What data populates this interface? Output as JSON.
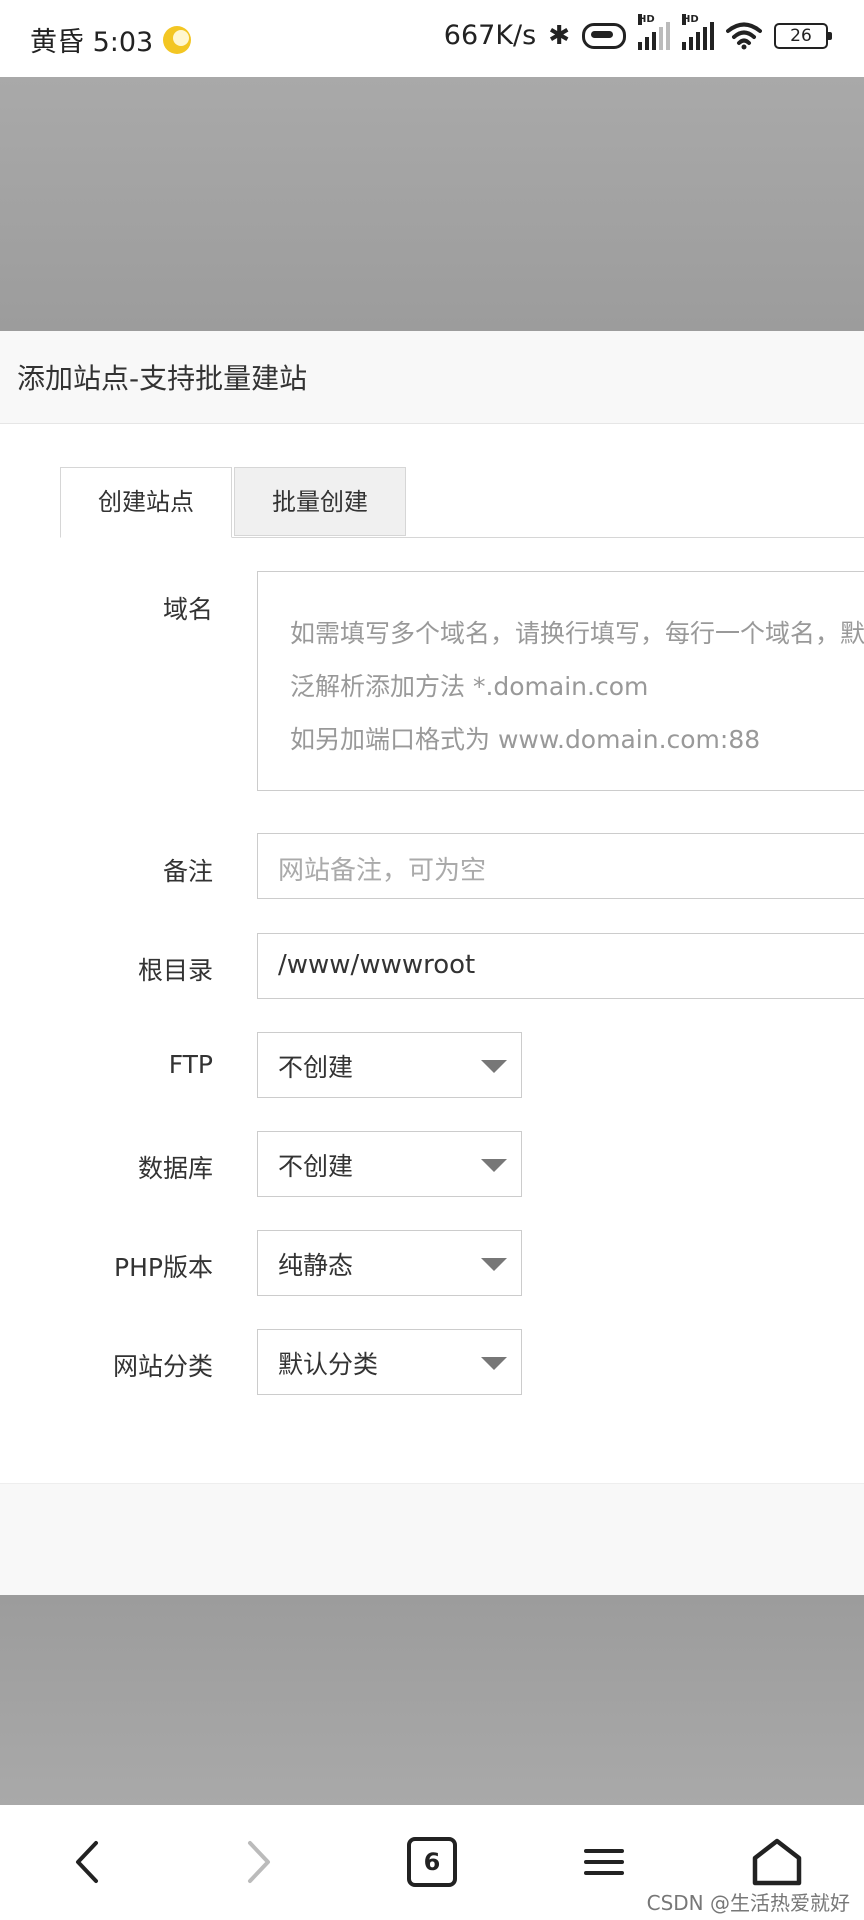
{
  "status_bar": {
    "time": "黄昏 5:03",
    "net_speed": "667K/s",
    "signal_hd_1": "HD",
    "signal_hd_2": "HD",
    "battery": "26",
    "icons": [
      "moon-icon",
      "bluetooth-icon",
      "vibrate-icon",
      "signal-icon",
      "signal-icon",
      "wifi-icon",
      "battery-icon"
    ]
  },
  "dialog": {
    "title": "添加站点-支持批量建站",
    "tabs": [
      {
        "label": "创建站点",
        "active": true
      },
      {
        "label": "批量创建",
        "active": false
      }
    ],
    "form": {
      "domain": {
        "label": "域名",
        "placeholder_lines": [
          "如需填写多个域名，请换行填写，每行一个域名，默",
          "泛解析添加方法 *.domain.com",
          "如另加端口格式为 www.domain.com:88"
        ]
      },
      "remark": {
        "label": "备注",
        "placeholder": "网站备注，可为空"
      },
      "root_dir": {
        "label": "根目录",
        "value": "/www/wwwroot"
      },
      "ftp": {
        "label": "FTP",
        "selected": "不创建"
      },
      "database": {
        "label": "数据库",
        "selected": "不创建"
      },
      "php_version": {
        "label": "PHP版本",
        "selected": "纯静态"
      },
      "site_category": {
        "label": "网站分类",
        "selected": "默认分类"
      }
    }
  },
  "bottom_nav": {
    "tab_count": "6",
    "icons": [
      "back-icon",
      "forward-icon",
      "tabs-icon",
      "menu-icon",
      "home-icon"
    ]
  },
  "watermark": "CSDN @生活热爱就好",
  "colors": {
    "overlay": "#a3a3a3",
    "dialog_header": "#f8f8f8",
    "border": "#cccccc"
  }
}
